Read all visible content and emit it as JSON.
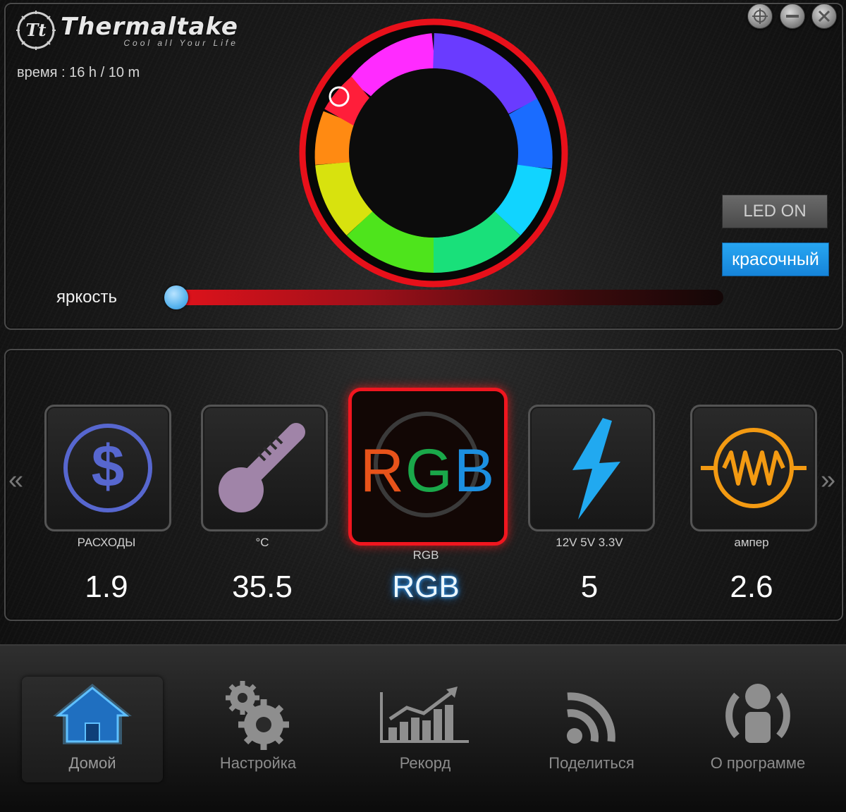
{
  "app": {
    "brand_name": "Thermaltake",
    "slogan": "Cool all Your Life",
    "time_text": "время : 16 h / 10 m"
  },
  "window_controls": [
    "move-icon",
    "minimize-icon",
    "close-icon"
  ],
  "color_picker": {
    "ring_color": "#e8101a",
    "selected_hue_marker": "red-orange"
  },
  "buttons": {
    "led_label": "LED ON",
    "mode_label": "красочный",
    "mode_color": "#1e96e8"
  },
  "brightness": {
    "label": "яркость",
    "level_percent": 0
  },
  "tiles": [
    {
      "icon": "dollar-icon",
      "label": "РАСХОДЫ",
      "value": "1.9"
    },
    {
      "icon": "thermometer-icon",
      "label": "°C",
      "value": "35.5"
    },
    {
      "icon": "rgb-icon",
      "icon_text_r": "R",
      "icon_text_g": "G",
      "icon_text_b": "B",
      "label": "RGB",
      "value": "RGB"
    },
    {
      "icon": "lightning-icon",
      "label": "12V 5V 3.3V",
      "value": "5"
    },
    {
      "icon": "resistor-icon",
      "label": "ампер",
      "value": "2.6"
    }
  ],
  "nav": [
    {
      "icon": "home-icon",
      "label": "Домой",
      "active": true
    },
    {
      "icon": "gears-icon",
      "label": "Настройка"
    },
    {
      "icon": "chart-icon",
      "label": "Рекорд"
    },
    {
      "icon": "rss-icon",
      "label": "Поделиться"
    },
    {
      "icon": "user-icon",
      "label": "О программе"
    }
  ]
}
